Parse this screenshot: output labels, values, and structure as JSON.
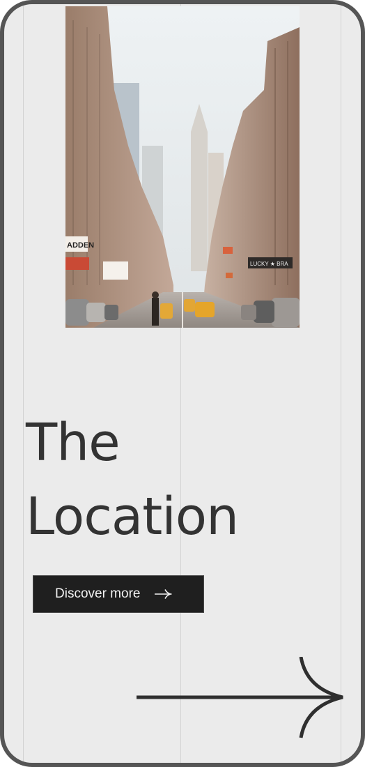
{
  "page": {
    "title_line1": "The",
    "title_line2": "Location"
  },
  "cta": {
    "label": "Discover more",
    "icon": "arrow-right-icon"
  },
  "photo": {
    "subject": "city street with yellow taxis",
    "signs": [
      "ADDEN",
      "LUCKY ★ BRA"
    ]
  },
  "next_arrow": {
    "icon": "arrow-right-large-icon"
  },
  "colors": {
    "background": "#ebebeb",
    "frame": "#555555",
    "text": "#333333",
    "button": "#1f1f1f",
    "button_text": "#f2f2f2"
  }
}
